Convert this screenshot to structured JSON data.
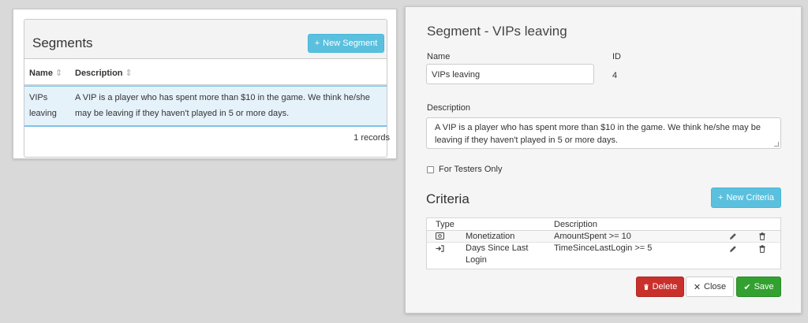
{
  "segments_panel": {
    "title": "Segments",
    "new_button_label": "New Segment",
    "columns": [
      "Name",
      "Description"
    ],
    "rows": [
      {
        "name": "VIPs leaving",
        "description": "A VIP is a player who has spent more than $10 in the game. We think he/she may be leaving if they haven't played in 5 or more days."
      }
    ],
    "records_label": "1 records"
  },
  "detail_panel": {
    "title": "Segment - VIPs leaving",
    "name_label": "Name",
    "name_value": "VIPs leaving",
    "id_label": "ID",
    "id_value": "4",
    "description_label": "Description",
    "description_value": "A VIP is a player who has spent more than $10 in the game.  We think he/she may be leaving if they haven't played in 5 or more days.",
    "testers_only_label": "For Testers Only",
    "testers_only_checked": false
  },
  "criteria": {
    "title": "Criteria",
    "new_button_label": "New Criteria",
    "columns": [
      "Type",
      "Description"
    ],
    "rows": [
      {
        "type_icon": "money-icon",
        "type": "Monetization",
        "description": "AmountSpent >= 10"
      },
      {
        "type_icon": "login-icon",
        "type": "Days Since Last Login",
        "description": "TimeSinceLastLogin >= 5"
      }
    ]
  },
  "actions": {
    "delete_label": "Delete",
    "close_label": "Close",
    "save_label": "Save"
  },
  "colors": {
    "info": "#5bc0de",
    "danger": "#c9302c",
    "success": "#33a130",
    "selected_row": "#e5f2fa"
  }
}
